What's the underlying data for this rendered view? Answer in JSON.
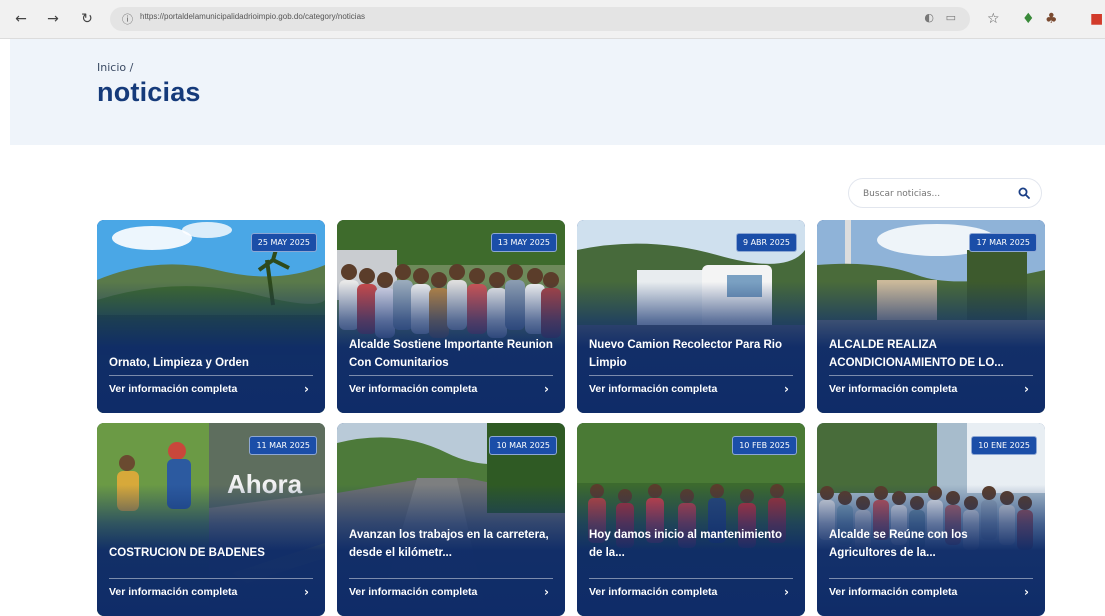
{
  "browser": {
    "url": "https://portaldelamunicipalidadrioimpio.gob.do/category/noticias",
    "back_glyph": "←",
    "forward_glyph": "→",
    "reload_glyph": "↻"
  },
  "hero": {
    "breadcrumb": "Inicio /",
    "title": "noticias"
  },
  "search": {
    "placeholder": "Buscar noticias..."
  },
  "cards": [
    {
      "date": "25 MAY 2025",
      "title": "Ornato, Limpieza y Orden",
      "link": "Ver información completa",
      "photo": "mountain-landscape"
    },
    {
      "date": "13 MAY 2025",
      "title": "Alcalde Sostiene Importante Reunion Con Comunitarios",
      "link": "Ver información completa",
      "photo": "group-meeting"
    },
    {
      "date": "9 ABR 2025",
      "title": "Nuevo Camion Recolector Para Rio Limpio",
      "link": "Ver información completa",
      "photo": "garbage-truck"
    },
    {
      "date": "17 MAR 2025",
      "title": "ALCALDE REALIZA ACONDICIONAMIENTO DE LO...",
      "link": "Ver información completa",
      "photo": "town-square"
    },
    {
      "date": "11 MAR 2025",
      "title": "COSTRUCION DE BADENES",
      "link": "Ver información completa",
      "photo": "ahora-collage",
      "overlay_text": "Ahora"
    },
    {
      "date": "10 MAR 2025",
      "title": "Avanzan los trabajos en la carretera, desde el kilómetr...",
      "link": "Ver información completa",
      "photo": "rural-road"
    },
    {
      "date": "10 FEB 2025",
      "title": "Hoy damos inicio al mantenimiento de la...",
      "link": "Ver información completa",
      "photo": "workers-forest"
    },
    {
      "date": "10 ENE 2025",
      "title": "Alcalde se Reúne con los Agricultores de la...",
      "link": "Ver información completa",
      "photo": "farmers-crowd"
    }
  ],
  "colors": {
    "brand_blue": "#153a7a",
    "card_blue": "#0f2c68",
    "badge_blue": "#1b4ea8",
    "hero_bg": "#eff4fa"
  }
}
